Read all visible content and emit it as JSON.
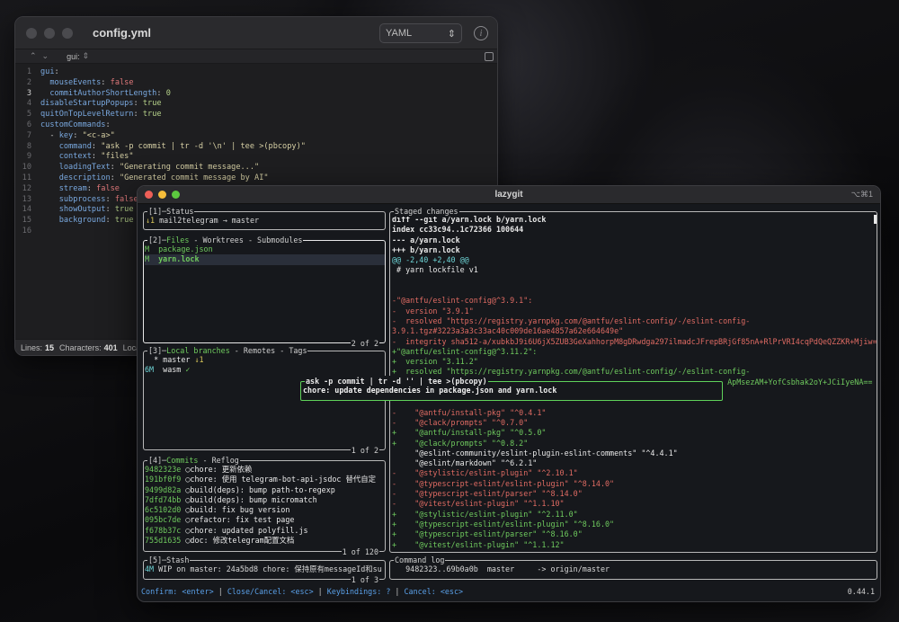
{
  "editor": {
    "filename": "config.yml",
    "language": "YAML",
    "breadcrumb": "gui:",
    "lines": [
      {
        "n": "1",
        "parts": [
          {
            "c": "k",
            "t": "gui"
          },
          {
            "c": "p",
            "t": ":"
          }
        ]
      },
      {
        "n": "2",
        "parts": [
          {
            "c": "p",
            "t": "  "
          },
          {
            "c": "k",
            "t": "mouseEvents"
          },
          {
            "c": "p",
            "t": ": "
          },
          {
            "c": "b",
            "t": "false"
          }
        ]
      },
      {
        "n": "3",
        "parts": [
          {
            "c": "p",
            "t": "  "
          },
          {
            "c": "k",
            "t": "commitAuthorShortLength"
          },
          {
            "c": "p",
            "t": ": "
          },
          {
            "c": "n",
            "t": "0"
          }
        ]
      },
      {
        "n": "4",
        "parts": [
          {
            "c": "k",
            "t": "disableStartupPopups"
          },
          {
            "c": "p",
            "t": ": "
          },
          {
            "c": "n",
            "t": "true"
          }
        ]
      },
      {
        "n": "5",
        "parts": [
          {
            "c": "k",
            "t": "quitOnTopLevelReturn"
          },
          {
            "c": "p",
            "t": ": "
          },
          {
            "c": "n",
            "t": "true"
          }
        ]
      },
      {
        "n": "6",
        "parts": [
          {
            "c": "k",
            "t": "customCommands"
          },
          {
            "c": "p",
            "t": ":"
          }
        ]
      },
      {
        "n": "7",
        "parts": [
          {
            "c": "p",
            "t": "  - "
          },
          {
            "c": "k",
            "t": "key"
          },
          {
            "c": "p",
            "t": ": "
          },
          {
            "c": "s",
            "t": "\"<c-a>\""
          }
        ]
      },
      {
        "n": "8",
        "parts": [
          {
            "c": "p",
            "t": "    "
          },
          {
            "c": "k",
            "t": "command"
          },
          {
            "c": "p",
            "t": ": "
          },
          {
            "c": "s",
            "t": "\"ask -p commit | tr -d '\\n' | tee >(pbcopy)\""
          }
        ]
      },
      {
        "n": "9",
        "parts": [
          {
            "c": "p",
            "t": "    "
          },
          {
            "c": "k",
            "t": "context"
          },
          {
            "c": "p",
            "t": ": "
          },
          {
            "c": "s",
            "t": "\"files\""
          }
        ]
      },
      {
        "n": "10",
        "parts": [
          {
            "c": "p",
            "t": "    "
          },
          {
            "c": "k",
            "t": "loadingText"
          },
          {
            "c": "p",
            "t": ": "
          },
          {
            "c": "s",
            "t": "\"Generating commit message...\""
          }
        ]
      },
      {
        "n": "11",
        "parts": [
          {
            "c": "p",
            "t": "    "
          },
          {
            "c": "k",
            "t": "description"
          },
          {
            "c": "p",
            "t": ": "
          },
          {
            "c": "s",
            "t": "\"Generated commit message by AI\""
          }
        ]
      },
      {
        "n": "12",
        "parts": [
          {
            "c": "p",
            "t": "    "
          },
          {
            "c": "k",
            "t": "stream"
          },
          {
            "c": "p",
            "t": ": "
          },
          {
            "c": "b",
            "t": "false"
          }
        ]
      },
      {
        "n": "13",
        "parts": [
          {
            "c": "p",
            "t": "    "
          },
          {
            "c": "k",
            "t": "subprocess"
          },
          {
            "c": "p",
            "t": ": "
          },
          {
            "c": "b",
            "t": "false"
          }
        ]
      },
      {
        "n": "14",
        "parts": [
          {
            "c": "p",
            "t": "    "
          },
          {
            "c": "k",
            "t": "showOutput"
          },
          {
            "c": "p",
            "t": ": "
          },
          {
            "c": "n",
            "t": "true"
          }
        ]
      },
      {
        "n": "15",
        "parts": [
          {
            "c": "p",
            "t": "    "
          },
          {
            "c": "k",
            "t": "background"
          },
          {
            "c": "p",
            "t": ": "
          },
          {
            "c": "n",
            "t": "true"
          }
        ]
      },
      {
        "n": "16",
        "parts": []
      }
    ],
    "active_line": "3",
    "status": {
      "lines_label": "Lines:",
      "lines": "15",
      "chars_label": "Characters:",
      "chars": "401",
      "location_label": "Location"
    }
  },
  "lazygit": {
    "title": "lazygit",
    "shortcut": "⌥⌘1",
    "status": {
      "title": "[1]─Status",
      "pull": "↓1",
      "repo": " mail2telegram → master"
    },
    "files": {
      "title_num": "[2]─",
      "title_files": "Files",
      "title_rest": " - Worktrees - Submodules",
      "items": [
        {
          "status": "M",
          "name": "  package.json",
          "selected": false
        },
        {
          "status": "M",
          "name": "  yarn.lock",
          "selected": true
        }
      ],
      "footer": "2 of 2"
    },
    "branches": {
      "title_num": "[3]─",
      "title_local": "Local branches",
      "title_rest": " - Remotes - Tags",
      "items": [
        {
          "prefix": "  * ",
          "name": "master",
          "suffix": " ↓1"
        },
        {
          "prefix": "6M  ",
          "name": "wasm",
          "suffix": " ✓"
        }
      ],
      "footer": "1 of 2"
    },
    "commits": {
      "title_num": "[4]─",
      "title_commits": "Commits",
      "title_rest": " - Reflog",
      "items": [
        {
          "hash": "9482323e",
          "msg": " ◯chore: 更新依赖"
        },
        {
          "hash": "191bf0f9",
          "msg": " ◯chore: 使用 telegram-bot-api-jsdoc 替代自定"
        },
        {
          "hash": "9499d82a",
          "msg": " ◯build(deps): bump path-to-regexp"
        },
        {
          "hash": "7dfd74bb",
          "msg": " ◯build(deps): bump micromatch"
        },
        {
          "hash": "6c5102d0",
          "msg": " ◯build: fix bug version"
        },
        {
          "hash": "095bc7de",
          "msg": " ◯refactor: fix test page"
        },
        {
          "hash": "f678b37c",
          "msg": " ◯chore: updated polyfill.js"
        },
        {
          "hash": "755d1635",
          "msg": " ◯doc: 修改telegram配置文档"
        }
      ],
      "footer": "1 of 120"
    },
    "stash": {
      "title": "[5]─Stash",
      "item_prefix": "4M",
      "item": " WIP on master: 24a5bd8 chore: 保持原有messageId和su",
      "footer": "1 of 3"
    },
    "staged": {
      "title": "Staged changes",
      "lines": [
        {
          "c": "white bold",
          "t": "diff --git a/yarn.lock b/yarn.lock"
        },
        {
          "c": "white bold",
          "t": "index cc33c94..1c72366 100644"
        },
        {
          "c": "white bold",
          "t": "--- a/yarn.lock"
        },
        {
          "c": "white bold",
          "t": "+++ b/yarn.lock"
        },
        {
          "c": "cyan",
          "t": "@@ -2,40 +2,40 @@"
        },
        {
          "c": "white",
          "t": " # yarn lockfile v1"
        },
        {
          "c": "white",
          "t": " "
        },
        {
          "c": "white",
          "t": " "
        },
        {
          "c": "red",
          "t": "-\"@antfu/eslint-config@^3.9.1\":"
        },
        {
          "c": "red",
          "t": "-  version \"3.9.1\""
        },
        {
          "c": "red",
          "t": "-  resolved \"https://registry.yarnpkg.com/@antfu/eslint-config/-/eslint-config-"
        },
        {
          "c": "red",
          "t": "3.9.1.tgz#3223a3a3c33ac40c009de16ae4857a62e664649e\""
        },
        {
          "c": "red",
          "t": "-  integrity sha512-a/xubkbJ9i6U6jX5ZUB3GeXahhorpM8gDRwdga297ilmadcJFrepBRjGf85nA+RlPrVRI4cqPdQeQZZKR+Mjiw=="
        },
        {
          "c": "green",
          "t": "+\"@antfu/eslint-config@^3.11.2\":"
        },
        {
          "c": "green",
          "t": "+  version \"3.11.2\""
        },
        {
          "c": "green",
          "t": "+  resolved \"https://registry.yarnpkg.com/@antfu/eslint-config/-/eslint-config-"
        },
        {
          "c": "green",
          "t": "                                                                          ApMsezAM+YofCsbhak2oY+JCiIyeNA=="
        },
        {
          "c": "white",
          "t": " "
        },
        {
          "c": "white",
          "t": " "
        },
        {
          "c": "red",
          "t": "-    \"@antfu/install-pkg\" \"^0.4.1\""
        },
        {
          "c": "red",
          "t": "-    \"@clack/prompts\" \"^0.7.0\""
        },
        {
          "c": "green",
          "t": "+    \"@antfu/install-pkg\" \"^0.5.0\""
        },
        {
          "c": "green",
          "t": "+    \"@clack/prompts\" \"^0.8.2\""
        },
        {
          "c": "white",
          "t": "     \"@eslint-community/eslint-plugin-eslint-comments\" \"^4.4.1\""
        },
        {
          "c": "white",
          "t": "     \"@eslint/markdown\" \"^6.2.1\""
        },
        {
          "c": "red",
          "t": "-    \"@stylistic/eslint-plugin\" \"^2.10.1\""
        },
        {
          "c": "red",
          "t": "-    \"@typescript-eslint/eslint-plugin\" \"^8.14.0\""
        },
        {
          "c": "red",
          "t": "-    \"@typescript-eslint/parser\" \"^8.14.0\""
        },
        {
          "c": "red",
          "t": "-    \"@vitest/eslint-plugin\" \"^1.1.10\""
        },
        {
          "c": "green",
          "t": "+    \"@stylistic/eslint-plugin\" \"^2.11.0\""
        },
        {
          "c": "green",
          "t": "+    \"@typescript-eslint/eslint-plugin\" \"^8.16.0\""
        },
        {
          "c": "green",
          "t": "+    \"@typescript-eslint/parser\" \"^8.16.0\""
        },
        {
          "c": "green",
          "t": "+    \"@vitest/eslint-plugin\" \"^1.1.12\""
        }
      ]
    },
    "popup": {
      "title": "ask -p commit | tr -d '' | tee >(pbcopy)",
      "message": "chore: update dependencies in package.json and yarn.lock"
    },
    "command_log": {
      "title": "Command log",
      "line": "   9482323..69b0a0b  master     -> origin/master"
    },
    "bottombar": {
      "confirm": "Confirm: <enter>",
      "close": "Close/Cancel: <esc>",
      "keybindings": "Keybindings: ?",
      "cancel": "Cancel: <esc>",
      "sep": " | "
    },
    "version": "0.44.1"
  },
  "colors": {
    "diff_add": "#6fca5e",
    "diff_remove": "#e06b63",
    "hunk": "#6ed4d6",
    "keybinding": "#5aa0e8",
    "popup_border": "#5fd25a"
  }
}
